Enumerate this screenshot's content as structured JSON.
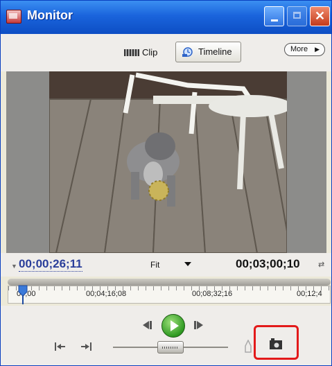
{
  "window": {
    "title": "Monitor",
    "controls": {
      "minimize": "minimize-icon",
      "maximize": "maximize-icon",
      "close": "✕"
    }
  },
  "toolbar": {
    "clip_label": "Clip",
    "timeline_label": "Timeline",
    "more_label": "More",
    "more_arrow": "▶"
  },
  "preview": {
    "description_icon": "video-frame"
  },
  "timecode": {
    "current": "00;00;26;11",
    "zoom": "Fit",
    "duration": "00;03;00;10",
    "loop_icon": "⇄"
  },
  "ruler": {
    "ticks": [
      "00;00",
      "00;04;16;08",
      "00;08;32;16",
      "00;12;4"
    ]
  },
  "colors": {
    "titlebar": "#1a64dc",
    "accent_timecode": "#2a3e9a",
    "play_green": "#2f9a22",
    "highlight": "#e31a1a"
  }
}
